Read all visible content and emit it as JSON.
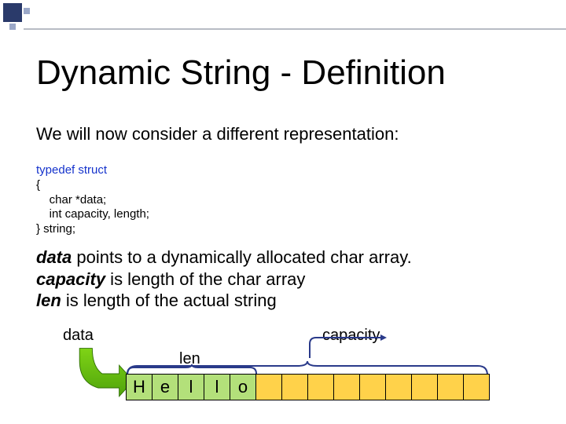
{
  "title": "Dynamic String - Definition",
  "intro": "We will now consider a different representation:",
  "code": {
    "kw_typedef": "typedef",
    "kw_struct": "struct",
    "brace_open": "{",
    "line_data": "    char *data;",
    "line_cap": "    int capacity, length;",
    "brace_close": "} string;"
  },
  "desc": {
    "data_em": "data",
    "data_rest": "  points to a dynamically allocated char array.",
    "cap_em": "capacity",
    "cap_rest": " is length of the char array",
    "len_em": "len",
    "len_rest": " is length of the actual string"
  },
  "diagram": {
    "label_data": "data",
    "label_len": "len",
    "label_capacity": "capacity",
    "cells": [
      "H",
      "e",
      "l",
      "l",
      "o",
      "",
      "",
      "",
      "",
      "",
      "",
      "",
      "",
      ""
    ],
    "len": 5,
    "capacity": 14
  }
}
